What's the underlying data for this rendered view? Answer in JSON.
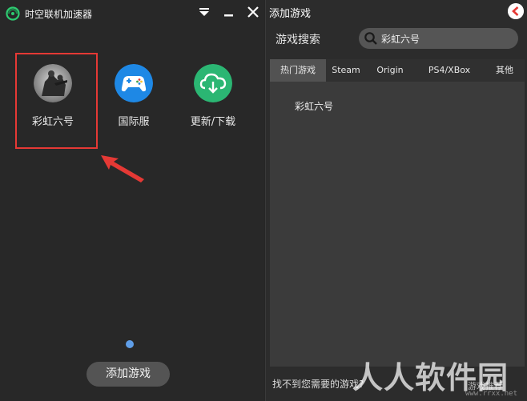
{
  "app": {
    "title": "时空联机加速器"
  },
  "tiles": [
    {
      "label": "彩虹六号",
      "icon": "rainbow-six-game-icon"
    },
    {
      "label": "国际服",
      "icon": "gamepad-icon"
    },
    {
      "label": "更新/下载",
      "icon": "cloud-download-icon"
    }
  ],
  "left_panel": {
    "add_game_button": "添加游戏"
  },
  "right_panel": {
    "title": "添加游戏",
    "search_label": "游戏搜索",
    "search_value": "彩虹六号",
    "tabs": [
      {
        "label": "热门游戏",
        "active": true
      },
      {
        "label": "Steam",
        "active": false
      },
      {
        "label": "Origin",
        "active": false
      },
      {
        "label": "PS4/XBox",
        "active": false
      },
      {
        "label": "其他",
        "active": false
      }
    ],
    "results": [
      "彩虹六号"
    ],
    "hint": "找不到您需要的游戏?",
    "recommend_button": "游戏推荐"
  },
  "watermark": {
    "text": "人人软件园",
    "url": "www.rrxx.net"
  },
  "colors": {
    "accent_blue": "#5f9ee8",
    "highlight_red": "#e53935",
    "update_green": "#2bb673",
    "intl_blue": "#1e88e5"
  }
}
